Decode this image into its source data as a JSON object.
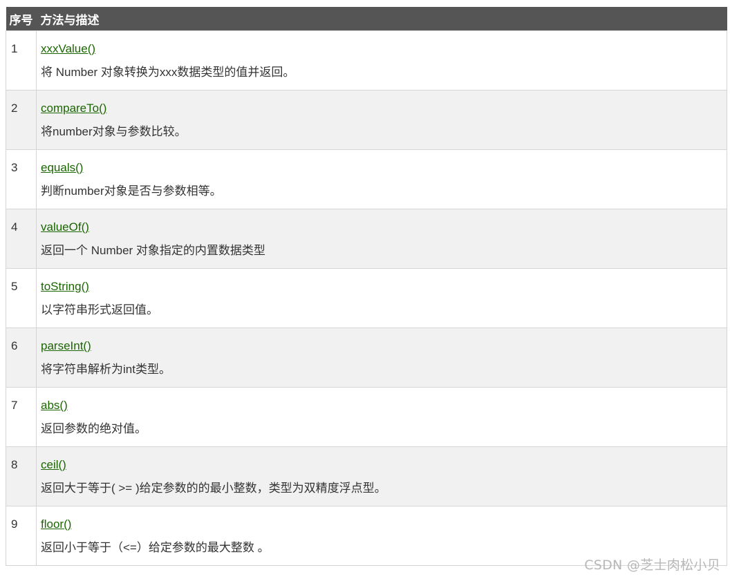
{
  "table": {
    "headers": [
      "序号",
      "方法与描述"
    ],
    "rows": [
      {
        "num": "1",
        "method": "xxxValue()",
        "description": "将 Number 对象转换为xxx数据类型的值并返回。"
      },
      {
        "num": "2",
        "method": "compareTo()",
        "description": "将number对象与参数比较。"
      },
      {
        "num": "3",
        "method": "equals()",
        "description": "判断number对象是否与参数相等。"
      },
      {
        "num": "4",
        "method": "valueOf()",
        "description": "返回一个 Number 对象指定的内置数据类型"
      },
      {
        "num": "5",
        "method": "toString()",
        "description": "以字符串形式返回值。"
      },
      {
        "num": "6",
        "method": "parseInt()",
        "description": "将字符串解析为int类型。"
      },
      {
        "num": "7",
        "method": "abs()",
        "description": "返回参数的绝对值。"
      },
      {
        "num": "8",
        "method": "ceil()",
        "description": "返回大于等于( >= )给定参数的的最小整数，类型为双精度浮点型。"
      },
      {
        "num": "9",
        "method": "floor()",
        "description": "返回小于等于（<=）给定参数的最大整数 。"
      }
    ]
  },
  "watermark": "CSDN @芝士肉松小贝",
  "colors": {
    "header_bg": "#555555",
    "link": "#1a6600",
    "row_alt_bg": "#f1f1f1",
    "border": "#d4d4d4"
  }
}
